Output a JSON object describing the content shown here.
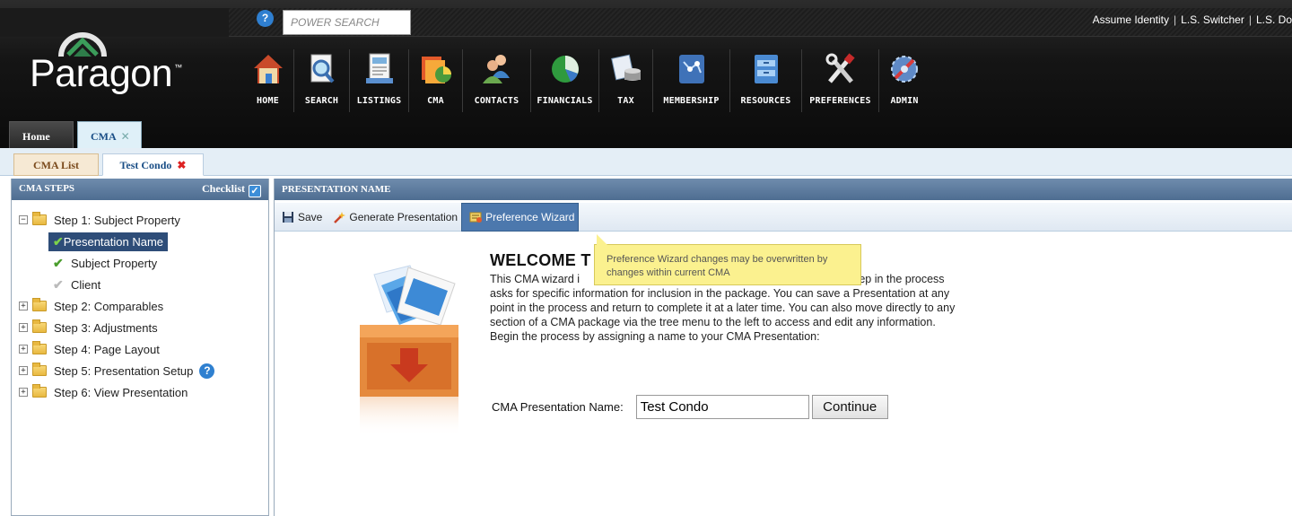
{
  "header": {
    "power_search_placeholder": "POWER SEARCH",
    "user_links": [
      "Assume Identity",
      "L.S. Switcher",
      "L.S. Do"
    ],
    "logo": "Paragon",
    "logo_tm": "™",
    "nav": [
      {
        "label": "HOME",
        "icon": "home-icon"
      },
      {
        "label": "SEARCH",
        "icon": "search-icon"
      },
      {
        "label": "LISTINGS",
        "icon": "listings-icon"
      },
      {
        "label": "CMA",
        "icon": "cma-icon"
      },
      {
        "label": "CONTACTS",
        "icon": "contacts-icon"
      },
      {
        "label": "FINANCIALS",
        "icon": "financials-icon"
      },
      {
        "label": "TAX",
        "icon": "tax-icon"
      },
      {
        "label": "MEMBERSHIP",
        "icon": "membership-icon"
      },
      {
        "label": "RESOURCES",
        "icon": "resources-icon"
      },
      {
        "label": "PREFERENCES",
        "icon": "preferences-icon"
      },
      {
        "label": "ADMIN",
        "icon": "admin-icon"
      }
    ],
    "tabs": {
      "home": "Home",
      "cma": "CMA",
      "close": "✕"
    }
  },
  "subtabs": {
    "list": "CMA List",
    "condo": "Test Condo",
    "close": "✖"
  },
  "left": {
    "title": "CMA STEPS",
    "checklist": "Checklist",
    "tree": {
      "step1": "Step 1: Subject Property",
      "presentation_name": "Presentation Name",
      "subject_property": "Subject Property",
      "client": "Client",
      "step2": "Step 2: Comparables",
      "step3": "Step 3: Adjustments",
      "step4": "Step 4: Page Layout",
      "step5": "Step 5: Presentation Setup",
      "step6": "Step 6: View Presentation"
    }
  },
  "main": {
    "title": "PRESENTATION NAME",
    "toolbar": {
      "save": "Save",
      "generate": "Generate Presentation",
      "wizard": "Preference Wizard"
    },
    "tooltip": "Preference Wizard changes may be overwritten by changes within current CMA",
    "welcome_title": "WELCOME T",
    "welcome_lines": [
      "This CMA wizard i",
      "asks for specific information for inclusion in the package. You can save a Presentation at any",
      "point in the process and return to complete it at a later time. You can also move directly to any",
      "section of a CMA package via the tree menu to the left to access and edit any information.",
      "Begin the process by assigning a name to your CMA Presentation:"
    ],
    "welcome_line1_tail": "ket. Each step in the process",
    "name_label": "CMA Presentation Name:",
    "name_value": "Test Condo",
    "continue": "Continue"
  }
}
